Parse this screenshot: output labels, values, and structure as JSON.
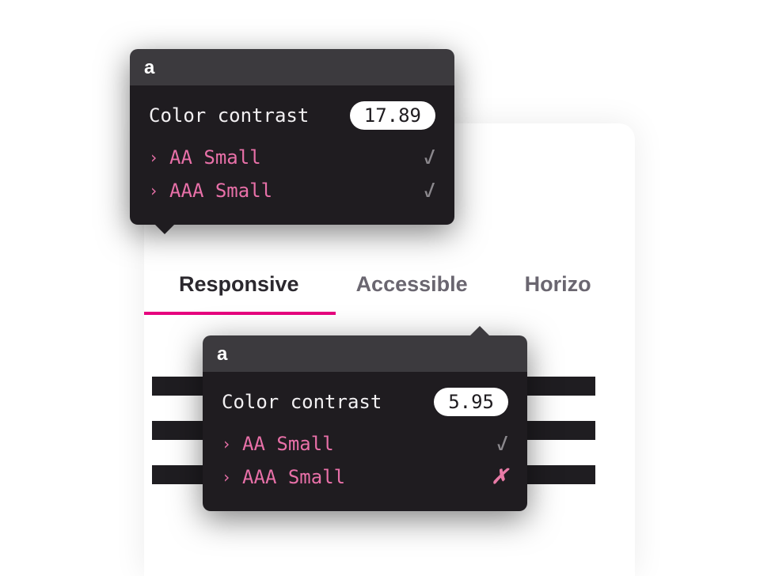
{
  "tabs": {
    "items": [
      {
        "label": "Responsive",
        "active": true
      },
      {
        "label": "Accessible",
        "active": false
      },
      {
        "label": "Horizo",
        "active": false
      }
    ]
  },
  "tooltips": {
    "top": {
      "header": "a",
      "title": "Color contrast",
      "value": "17.89",
      "checks": [
        {
          "label": "AA Small",
          "pass": true
        },
        {
          "label": "AAA Small",
          "pass": true
        }
      ]
    },
    "bottom": {
      "header": "a",
      "title": "Color contrast",
      "value": "5.95",
      "checks": [
        {
          "label": "AA Small",
          "pass": true
        },
        {
          "label": "AAA Small",
          "pass": false
        }
      ]
    }
  }
}
